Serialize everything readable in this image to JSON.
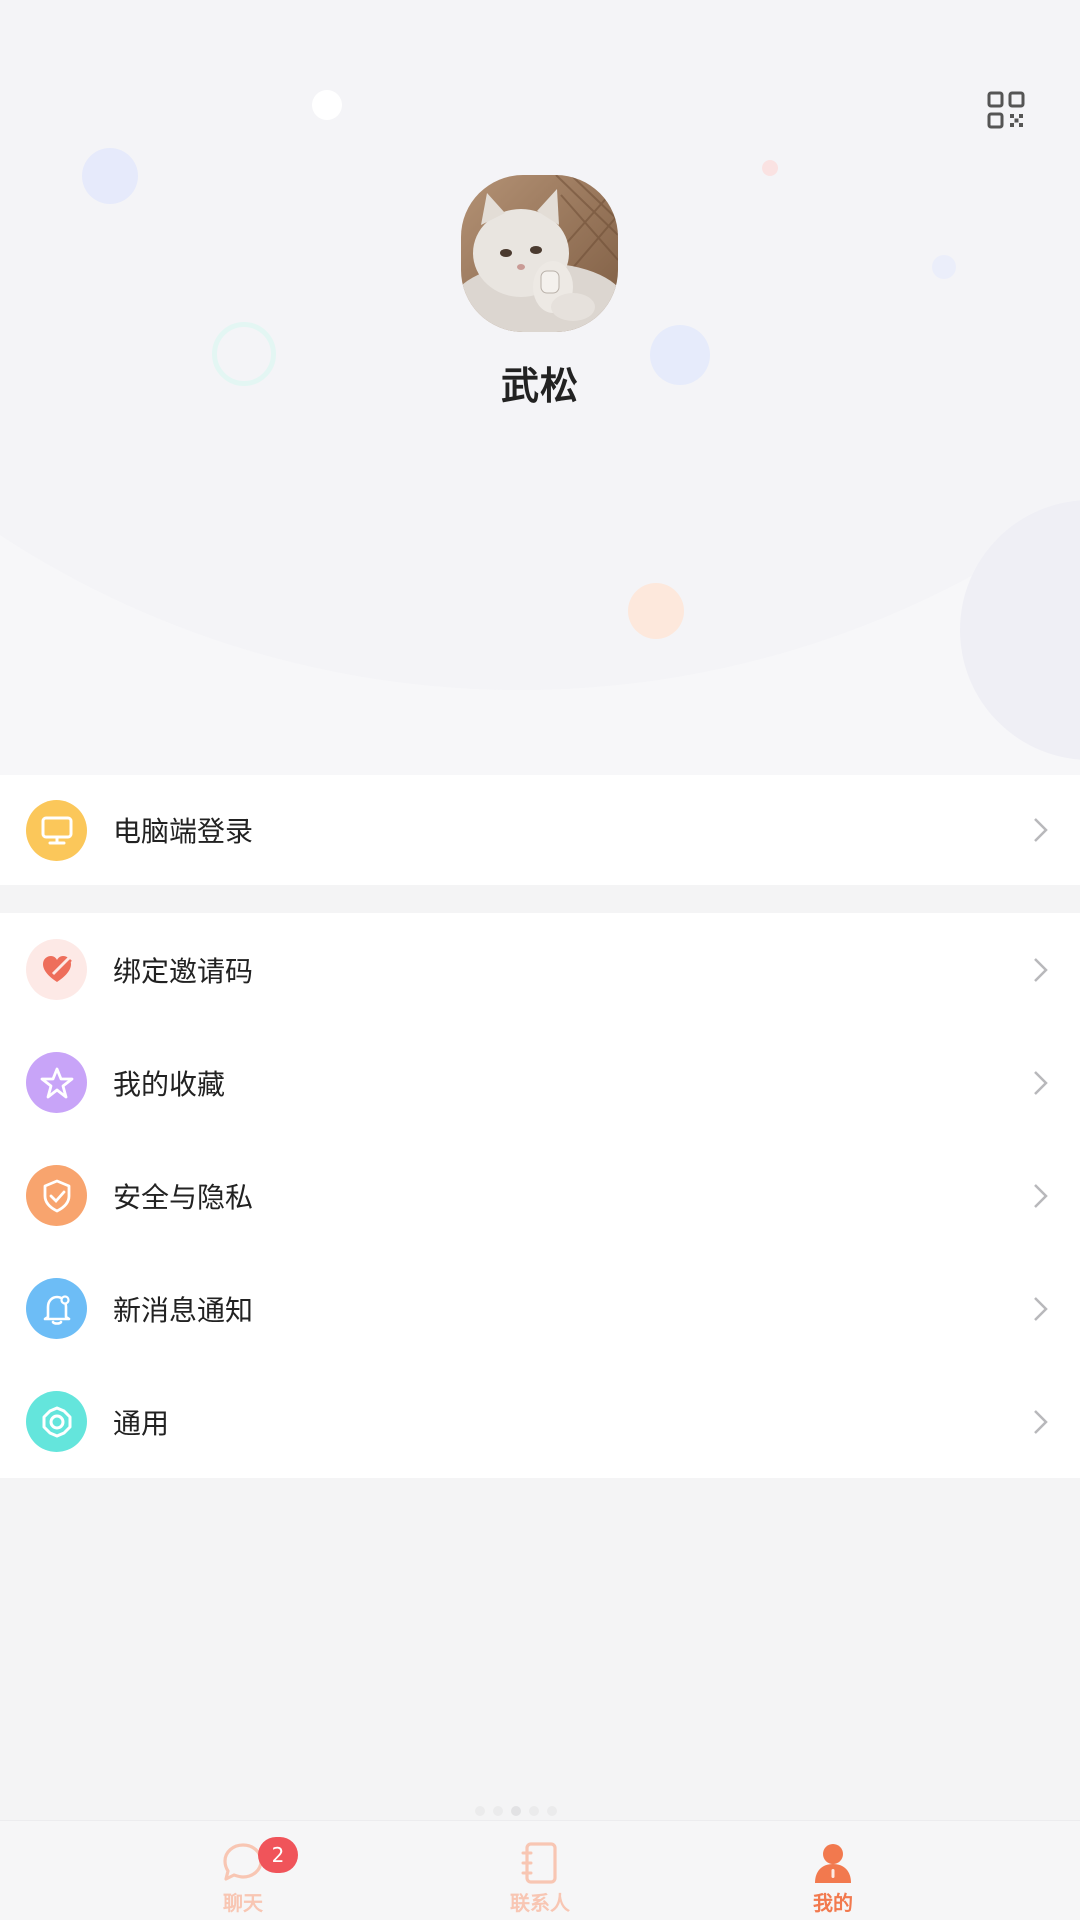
{
  "profile": {
    "name": "武松"
  },
  "menu": {
    "pc_login": {
      "label": "电脑端登录",
      "icon": "monitor-icon",
      "color": "#fbc75a"
    },
    "items": [
      {
        "label": "绑定邀请码",
        "icon": "heart-pen-icon",
        "color": "#fde9e6"
      },
      {
        "label": "我的收藏",
        "icon": "star-icon",
        "color": "#c8a4f8"
      },
      {
        "label": "安全与隐私",
        "icon": "shield-check-icon",
        "color": "#f8a46e"
      },
      {
        "label": "新消息通知",
        "icon": "bell-icon",
        "color": "#6dbdf6"
      },
      {
        "label": "通用",
        "icon": "gear-icon",
        "color": "#64e5dc"
      }
    ]
  },
  "tabbar": {
    "tabs": [
      {
        "label": "聊天",
        "icon": "chat-bubble-icon",
        "badge": "2",
        "active": false
      },
      {
        "label": "联系人",
        "icon": "contacts-book-icon",
        "active": false
      },
      {
        "label": "我的",
        "icon": "person-icon",
        "active": true
      }
    ],
    "colors": {
      "active": "#f2794e",
      "inactive": "#f8c6b3"
    }
  }
}
